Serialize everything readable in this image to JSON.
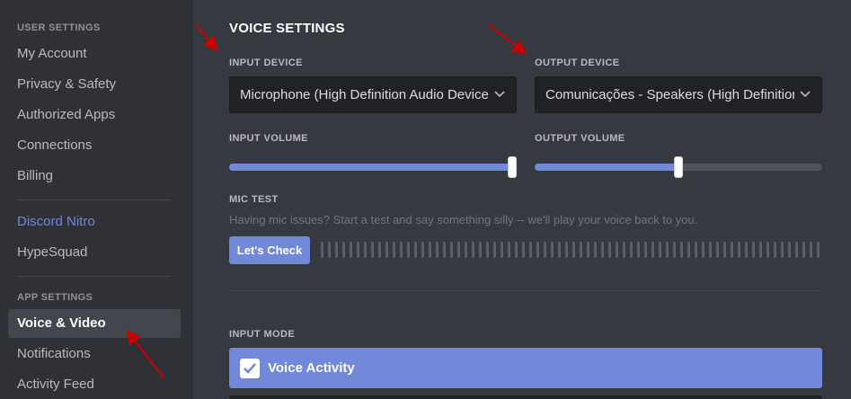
{
  "sidebar": {
    "user_settings_header": "USER SETTINGS",
    "items": [
      {
        "label": "My Account"
      },
      {
        "label": "Privacy & Safety"
      },
      {
        "label": "Authorized Apps"
      },
      {
        "label": "Connections"
      },
      {
        "label": "Billing"
      }
    ],
    "nitro_label": "Discord Nitro",
    "hypesquad_label": "HypeSquad",
    "app_settings_header": "APP SETTINGS",
    "app_items": [
      {
        "label": "Voice & Video",
        "active": true
      },
      {
        "label": "Notifications"
      },
      {
        "label": "Activity Feed"
      }
    ]
  },
  "main": {
    "title": "VOICE SETTINGS",
    "input_device": {
      "label": "INPUT DEVICE",
      "value": "Microphone (High Definition Audio Device)"
    },
    "output_device": {
      "label": "OUTPUT DEVICE",
      "value": "Comunicações - Speakers (High Definition Audio Device)"
    },
    "input_volume": {
      "label": "INPUT VOLUME",
      "level_percent": 100
    },
    "output_volume": {
      "label": "OUTPUT VOLUME",
      "level_percent": 50
    },
    "mic_test": {
      "label": "MIC TEST",
      "description": "Having mic issues? Start a test and say something silly -- we'll play your voice back to you.",
      "button_label": "Let's Check"
    },
    "input_mode": {
      "label": "INPUT MODE",
      "selected_option": "Voice Activity"
    }
  },
  "colors": {
    "accent": "#7289da",
    "annotation_arrow": "#cc0000"
  }
}
